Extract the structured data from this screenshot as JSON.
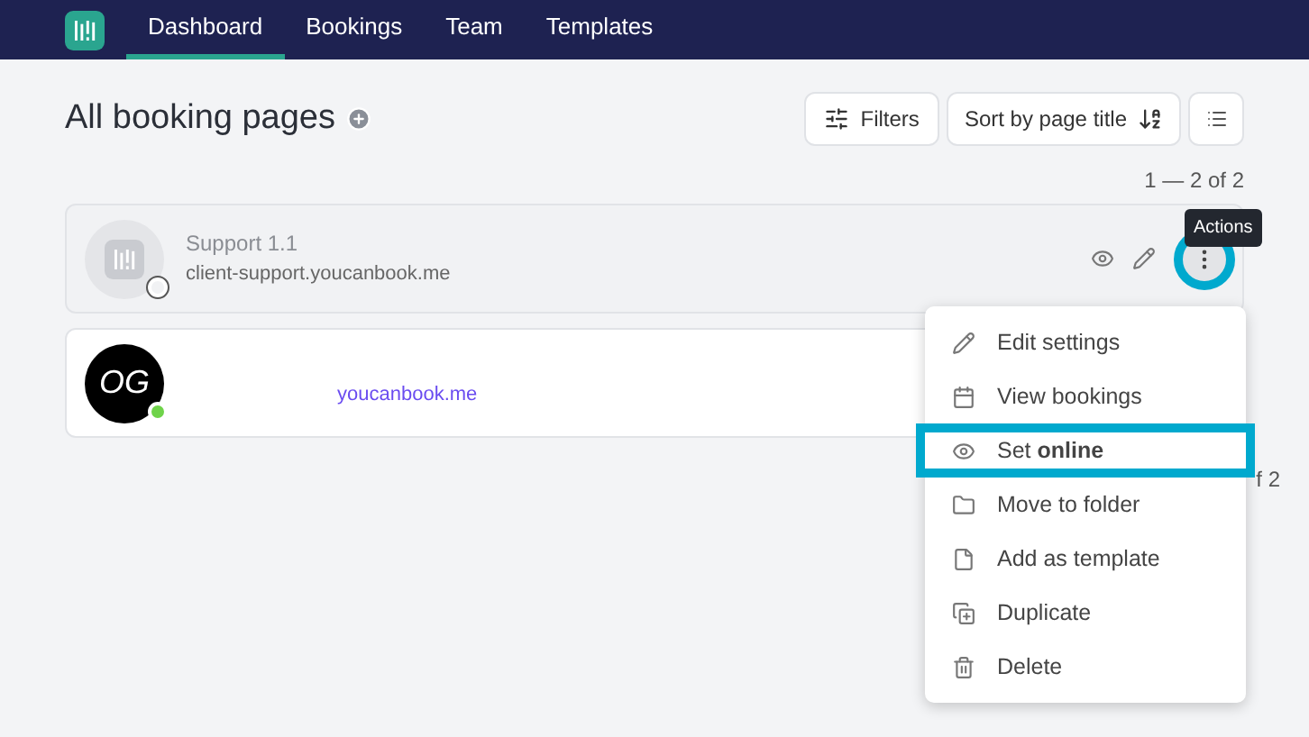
{
  "nav": {
    "tabs": [
      {
        "label": "Dashboard",
        "selected": true
      },
      {
        "label": "Bookings",
        "selected": false
      },
      {
        "label": "Team",
        "selected": false
      },
      {
        "label": "Templates",
        "selected": false
      }
    ]
  },
  "page": {
    "title": "All booking pages",
    "filters": "Filters",
    "sort": "Sort by page title",
    "pagination_top": "1 — 2 of 2",
    "pagination_bottom": "f 2"
  },
  "cards": [
    {
      "name": "Support 1.1",
      "url": "client-support.youcanbook.me",
      "online": false
    },
    {
      "url": "youcanbook.me",
      "online": true,
      "avatar_text": "OG"
    }
  ],
  "tooltip": "Actions",
  "menu": [
    {
      "kind": "edit",
      "label": "Edit settings",
      "highlighted": false
    },
    {
      "kind": "calendar",
      "label": "View bookings",
      "highlighted": false
    },
    {
      "kind": "eye",
      "label": "Set **online**",
      "highlighted": true
    },
    {
      "kind": "folder",
      "label": "Move to folder",
      "highlighted": false
    },
    {
      "kind": "file",
      "label": "Add as template",
      "highlighted": false
    },
    {
      "kind": "copy",
      "label": "Duplicate",
      "highlighted": false
    },
    {
      "kind": "trash",
      "label": "Delete",
      "highlighted": false
    }
  ]
}
